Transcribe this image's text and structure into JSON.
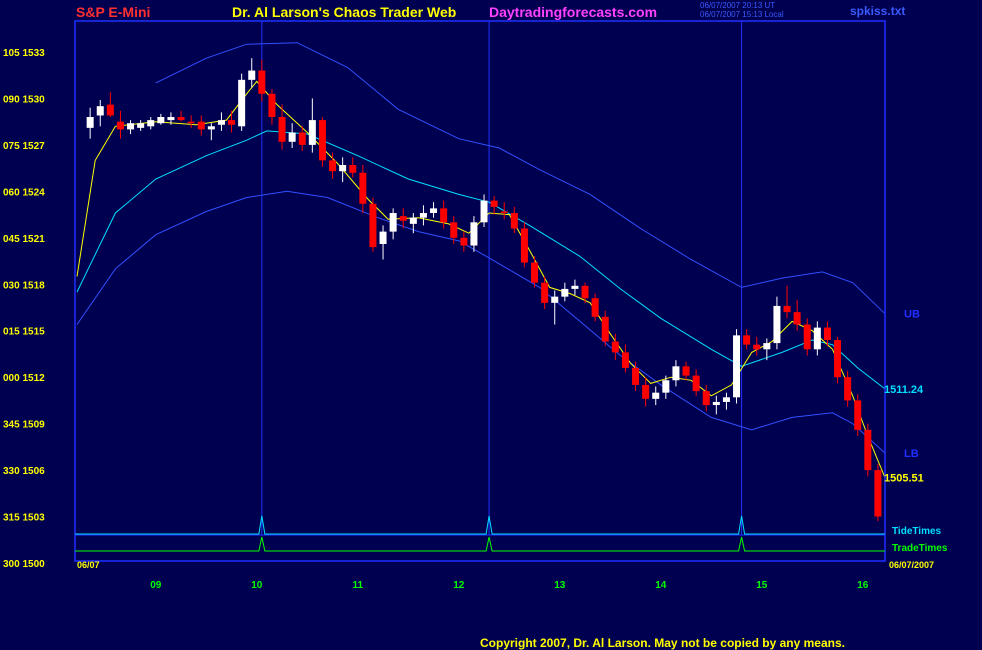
{
  "header": {
    "symbol": "S&P E-Mini",
    "title": "Dr. Al Larson's Chaos Trader Web",
    "site": "Daytradingforecasts.com",
    "stamp_utc": "06/07/2007 20:13 UT",
    "stamp_local": "06/07/2007 15:13 Local",
    "file": "spkiss.txt"
  },
  "footer": {
    "copyright": "Copyright 2007, Dr. Al Larson. May not be copied by any means."
  },
  "colors": {
    "background": "#000050",
    "frame": "#2030ff",
    "up_candle": "#ffffff",
    "down_candle": "#ff0000",
    "short_ema": "#ffff00",
    "center_band": "#00e0ff",
    "outer_band": "#3050ff",
    "tide_times": "#00e0ff",
    "trade_times": "#00ff00",
    "label_yellow": "#ffff00",
    "label_green": "#00ff00"
  },
  "chart_data": {
    "type": "candlestick",
    "x_range": [
      8.2,
      16.22
    ],
    "y_range": [
      1500,
      1535
    ],
    "y_ticks": [
      1500,
      1503,
      1506,
      1509,
      1512,
      1515,
      1518,
      1521,
      1524,
      1527,
      1530,
      1533
    ],
    "y_tick_labels": [
      "300 1500",
      "315 1503",
      "330 1506",
      "345 1509",
      "000 1512",
      "015 1515",
      "030 1518",
      "045 1521",
      "060 1524",
      "075 1527",
      "090 1530",
      "105 1533"
    ],
    "x_ticks": [
      9,
      10,
      11,
      12,
      13,
      14,
      15,
      16
    ],
    "x_tick_labels": [
      "09",
      "10",
      "11",
      "12",
      "13",
      "14",
      "15",
      "16"
    ],
    "date_left": "06/07",
    "date_right": "06/07/2007",
    "timing_lines": [
      10.05,
      12.3,
      14.8
    ],
    "band_labels": [
      {
        "text": "UB",
        "value": 1516.1
      },
      {
        "text": "1511.24",
        "value": 1511.24
      },
      {
        "text": "LB",
        "value": 1507.1
      },
      {
        "text": "1505.51",
        "value": 1505.51
      }
    ],
    "timing_labels": [
      "TideTimes",
      "TradeTimes"
    ],
    "candles": [
      {
        "t": 8.35,
        "o": 1528.1,
        "h": 1529.4,
        "l": 1527.4,
        "c": 1528.8
      },
      {
        "t": 8.45,
        "o": 1528.9,
        "h": 1529.9,
        "l": 1528.2,
        "c": 1529.5
      },
      {
        "t": 8.55,
        "o": 1529.6,
        "h": 1530.4,
        "l": 1528.8,
        "c": 1528.9
      },
      {
        "t": 8.65,
        "o": 1528.5,
        "h": 1529.2,
        "l": 1527.4,
        "c": 1528.0
      },
      {
        "t": 8.75,
        "o": 1528.0,
        "h": 1528.6,
        "l": 1527.7,
        "c": 1528.4
      },
      {
        "t": 8.85,
        "o": 1528.1,
        "h": 1528.6,
        "l": 1527.9,
        "c": 1528.4
      },
      {
        "t": 8.95,
        "o": 1528.2,
        "h": 1528.8,
        "l": 1528.0,
        "c": 1528.6
      },
      {
        "t": 9.05,
        "o": 1528.4,
        "h": 1529.0,
        "l": 1528.3,
        "c": 1528.8
      },
      {
        "t": 9.15,
        "o": 1528.6,
        "h": 1529.1,
        "l": 1528.3,
        "c": 1528.8
      },
      {
        "t": 9.25,
        "o": 1528.8,
        "h": 1529.2,
        "l": 1528.5,
        "c": 1528.6
      },
      {
        "t": 9.35,
        "o": 1528.5,
        "h": 1528.9,
        "l": 1528.1,
        "c": 1528.4
      },
      {
        "t": 9.45,
        "o": 1528.5,
        "h": 1528.9,
        "l": 1527.6,
        "c": 1528.0
      },
      {
        "t": 9.55,
        "o": 1528.0,
        "h": 1528.4,
        "l": 1527.3,
        "c": 1528.2
      },
      {
        "t": 9.65,
        "o": 1528.3,
        "h": 1529.1,
        "l": 1527.9,
        "c": 1528.6
      },
      {
        "t": 9.75,
        "o": 1528.6,
        "h": 1529.2,
        "l": 1527.8,
        "c": 1528.3
      },
      {
        "t": 9.85,
        "o": 1528.2,
        "h": 1531.6,
        "l": 1527.9,
        "c": 1531.2
      },
      {
        "t": 9.95,
        "o": 1531.2,
        "h": 1532.6,
        "l": 1530.7,
        "c": 1531.8
      },
      {
        "t": 10.05,
        "o": 1531.8,
        "h": 1532.5,
        "l": 1529.8,
        "c": 1530.3
      },
      {
        "t": 10.15,
        "o": 1530.3,
        "h": 1530.6,
        "l": 1528.3,
        "c": 1528.8
      },
      {
        "t": 10.25,
        "o": 1528.8,
        "h": 1529.6,
        "l": 1526.7,
        "c": 1527.2
      },
      {
        "t": 10.35,
        "o": 1527.2,
        "h": 1528.4,
        "l": 1526.8,
        "c": 1527.8
      },
      {
        "t": 10.45,
        "o": 1527.8,
        "h": 1528.2,
        "l": 1526.6,
        "c": 1527.0
      },
      {
        "t": 10.55,
        "o": 1527.0,
        "h": 1530.0,
        "l": 1526.5,
        "c": 1528.6
      },
      {
        "t": 10.65,
        "o": 1528.6,
        "h": 1528.8,
        "l": 1525.6,
        "c": 1526.0
      },
      {
        "t": 10.75,
        "o": 1526.0,
        "h": 1526.5,
        "l": 1524.8,
        "c": 1525.3
      },
      {
        "t": 10.85,
        "o": 1525.3,
        "h": 1526.2,
        "l": 1524.6,
        "c": 1525.7
      },
      {
        "t": 10.95,
        "o": 1525.7,
        "h": 1526.2,
        "l": 1524.9,
        "c": 1525.2
      },
      {
        "t": 11.05,
        "o": 1525.2,
        "h": 1525.7,
        "l": 1522.6,
        "c": 1523.2
      },
      {
        "t": 11.15,
        "o": 1523.2,
        "h": 1523.6,
        "l": 1520.1,
        "c": 1520.4
      },
      {
        "t": 11.25,
        "o": 1520.6,
        "h": 1521.8,
        "l": 1519.6,
        "c": 1521.4
      },
      {
        "t": 11.35,
        "o": 1521.4,
        "h": 1522.9,
        "l": 1520.9,
        "c": 1522.6
      },
      {
        "t": 11.45,
        "o": 1522.4,
        "h": 1522.9,
        "l": 1521.6,
        "c": 1522.1
      },
      {
        "t": 11.55,
        "o": 1521.9,
        "h": 1522.6,
        "l": 1521.3,
        "c": 1522.3
      },
      {
        "t": 11.65,
        "o": 1522.3,
        "h": 1523.1,
        "l": 1521.8,
        "c": 1522.6
      },
      {
        "t": 11.75,
        "o": 1522.6,
        "h": 1523.3,
        "l": 1522.3,
        "c": 1522.9
      },
      {
        "t": 11.85,
        "o": 1522.9,
        "h": 1523.4,
        "l": 1521.6,
        "c": 1522.0
      },
      {
        "t": 11.95,
        "o": 1522.0,
        "h": 1522.4,
        "l": 1520.6,
        "c": 1521.0
      },
      {
        "t": 12.05,
        "o": 1521.0,
        "h": 1521.4,
        "l": 1520.1,
        "c": 1520.5
      },
      {
        "t": 12.15,
        "o": 1520.5,
        "h": 1522.4,
        "l": 1520.1,
        "c": 1522.0
      },
      {
        "t": 12.25,
        "o": 1522.0,
        "h": 1523.8,
        "l": 1521.7,
        "c": 1523.4
      },
      {
        "t": 12.35,
        "o": 1523.4,
        "h": 1523.7,
        "l": 1522.5,
        "c": 1523.0
      },
      {
        "t": 12.45,
        "o": 1522.7,
        "h": 1523.3,
        "l": 1522.2,
        "c": 1522.6
      },
      {
        "t": 12.55,
        "o": 1522.6,
        "h": 1523.0,
        "l": 1521.3,
        "c": 1521.6
      },
      {
        "t": 12.65,
        "o": 1521.6,
        "h": 1522.0,
        "l": 1519.1,
        "c": 1519.4
      },
      {
        "t": 12.75,
        "o": 1519.4,
        "h": 1519.8,
        "l": 1517.8,
        "c": 1518.1
      },
      {
        "t": 12.85,
        "o": 1518.1,
        "h": 1518.5,
        "l": 1516.4,
        "c": 1516.8
      },
      {
        "t": 12.95,
        "o": 1516.8,
        "h": 1517.6,
        "l": 1515.4,
        "c": 1517.2
      },
      {
        "t": 13.05,
        "o": 1517.2,
        "h": 1518.1,
        "l": 1516.9,
        "c": 1517.7
      },
      {
        "t": 13.15,
        "o": 1517.7,
        "h": 1518.3,
        "l": 1517.3,
        "c": 1517.9
      },
      {
        "t": 13.25,
        "o": 1517.9,
        "h": 1518.1,
        "l": 1516.8,
        "c": 1517.1
      },
      {
        "t": 13.35,
        "o": 1517.1,
        "h": 1517.4,
        "l": 1515.6,
        "c": 1515.9
      },
      {
        "t": 13.45,
        "o": 1515.9,
        "h": 1516.3,
        "l": 1514.0,
        "c": 1514.3
      },
      {
        "t": 13.55,
        "o": 1514.3,
        "h": 1514.8,
        "l": 1513.1,
        "c": 1513.6
      },
      {
        "t": 13.65,
        "o": 1513.6,
        "h": 1514.1,
        "l": 1512.3,
        "c": 1512.6
      },
      {
        "t": 13.75,
        "o": 1512.6,
        "h": 1513.0,
        "l": 1511.1,
        "c": 1511.5
      },
      {
        "t": 13.85,
        "o": 1511.5,
        "h": 1512.0,
        "l": 1510.1,
        "c": 1510.6
      },
      {
        "t": 13.95,
        "o": 1510.6,
        "h": 1511.4,
        "l": 1510.2,
        "c": 1511.0
      },
      {
        "t": 14.05,
        "o": 1511.0,
        "h": 1512.1,
        "l": 1510.6,
        "c": 1511.8
      },
      {
        "t": 14.15,
        "o": 1511.8,
        "h": 1513.1,
        "l": 1511.4,
        "c": 1512.7
      },
      {
        "t": 14.25,
        "o": 1512.7,
        "h": 1513.0,
        "l": 1511.8,
        "c": 1512.1
      },
      {
        "t": 14.35,
        "o": 1512.1,
        "h": 1512.5,
        "l": 1510.8,
        "c": 1511.1
      },
      {
        "t": 14.45,
        "o": 1511.1,
        "h": 1511.5,
        "l": 1509.8,
        "c": 1510.2
      },
      {
        "t": 14.55,
        "o": 1510.2,
        "h": 1510.8,
        "l": 1509.6,
        "c": 1510.4
      },
      {
        "t": 14.65,
        "o": 1510.4,
        "h": 1511.0,
        "l": 1509.9,
        "c": 1510.7
      },
      {
        "t": 14.75,
        "o": 1510.7,
        "h": 1515.1,
        "l": 1510.3,
        "c": 1514.7
      },
      {
        "t": 14.85,
        "o": 1514.7,
        "h": 1515.1,
        "l": 1513.8,
        "c": 1514.1
      },
      {
        "t": 14.95,
        "o": 1514.1,
        "h": 1514.6,
        "l": 1513.4,
        "c": 1513.8
      },
      {
        "t": 15.05,
        "o": 1513.8,
        "h": 1514.5,
        "l": 1513.1,
        "c": 1514.2
      },
      {
        "t": 15.15,
        "o": 1514.2,
        "h": 1517.2,
        "l": 1513.8,
        "c": 1516.6
      },
      {
        "t": 15.25,
        "o": 1516.6,
        "h": 1517.9,
        "l": 1515.8,
        "c": 1516.2
      },
      {
        "t": 15.35,
        "o": 1516.2,
        "h": 1517.0,
        "l": 1515.0,
        "c": 1515.4
      },
      {
        "t": 15.45,
        "o": 1515.4,
        "h": 1515.8,
        "l": 1513.4,
        "c": 1513.8
      },
      {
        "t": 15.55,
        "o": 1513.8,
        "h": 1515.6,
        "l": 1513.4,
        "c": 1515.2
      },
      {
        "t": 15.65,
        "o": 1515.2,
        "h": 1515.6,
        "l": 1514.0,
        "c": 1514.4
      },
      {
        "t": 15.75,
        "o": 1514.4,
        "h": 1514.6,
        "l": 1511.6,
        "c": 1512.0
      },
      {
        "t": 15.85,
        "o": 1512.0,
        "h": 1512.4,
        "l": 1510.1,
        "c": 1510.5
      },
      {
        "t": 15.95,
        "o": 1510.5,
        "h": 1510.9,
        "l": 1508.2,
        "c": 1508.6
      },
      {
        "t": 16.05,
        "o": 1508.6,
        "h": 1509.0,
        "l": 1505.6,
        "c": 1506.0
      },
      {
        "t": 16.15,
        "o": 1506.0,
        "h": 1506.4,
        "l": 1502.7,
        "c": 1503.0
      }
    ],
    "series": [
      {
        "values": [
          [
            8.22,
            1518.5
          ],
          [
            8.4,
            1526
          ],
          [
            8.6,
            1528.2
          ],
          [
            9.0,
            1528.5
          ],
          [
            9.4,
            1528.3
          ],
          [
            9.7,
            1528.6
          ],
          [
            9.9,
            1530.3
          ],
          [
            10.0,
            1531.1
          ],
          [
            10.2,
            1529.6
          ],
          [
            10.5,
            1527.8
          ],
          [
            10.8,
            1525.8
          ],
          [
            11.1,
            1523.5
          ],
          [
            11.3,
            1522.2
          ],
          [
            11.6,
            1522.3
          ],
          [
            11.9,
            1521.9
          ],
          [
            12.1,
            1521.3
          ],
          [
            12.3,
            1522.6
          ],
          [
            12.5,
            1522.5
          ],
          [
            12.7,
            1520.2
          ],
          [
            12.9,
            1517.8
          ],
          [
            13.1,
            1517.4
          ],
          [
            13.3,
            1516.8
          ],
          [
            13.5,
            1514.8
          ],
          [
            13.7,
            1512.9
          ],
          [
            13.9,
            1511.6
          ],
          [
            14.1,
            1512.0
          ],
          [
            14.3,
            1511.8
          ],
          [
            14.5,
            1510.8
          ],
          [
            14.7,
            1511.5
          ],
          [
            14.9,
            1513.6
          ],
          [
            15.1,
            1514.3
          ],
          [
            15.3,
            1515.6
          ],
          [
            15.5,
            1515.0
          ],
          [
            15.7,
            1513.8
          ],
          [
            15.9,
            1510.8
          ],
          [
            16.05,
            1508.2
          ],
          [
            16.22,
            1505.51
          ]
        ]
      },
      {
        "values": [
          [
            8.22,
            1517.5
          ],
          [
            8.6,
            1522.6
          ],
          [
            9.0,
            1524.8
          ],
          [
            9.5,
            1526.3
          ],
          [
            9.9,
            1527.3
          ],
          [
            10.1,
            1527.9
          ],
          [
            10.5,
            1527.7
          ],
          [
            11.0,
            1526.3
          ],
          [
            11.5,
            1524.8
          ],
          [
            12.0,
            1523.8
          ],
          [
            12.3,
            1523.3
          ],
          [
            12.7,
            1521.8
          ],
          [
            13.2,
            1519.8
          ],
          [
            13.6,
            1517.7
          ],
          [
            14.0,
            1515.8
          ],
          [
            14.5,
            1513.8
          ],
          [
            14.8,
            1512.7
          ],
          [
            15.2,
            1513.6
          ],
          [
            15.5,
            1514.4
          ],
          [
            15.7,
            1514.1
          ],
          [
            15.95,
            1512.6
          ],
          [
            16.22,
            1511.24
          ]
        ]
      },
      {
        "values": [
          [
            8.22,
            1515.4
          ],
          [
            8.6,
            1519.0
          ],
          [
            9.0,
            1521.2
          ],
          [
            9.5,
            1522.7
          ],
          [
            9.9,
            1523.6
          ],
          [
            10.3,
            1524.0
          ],
          [
            10.7,
            1523.6
          ],
          [
            11.2,
            1522.3
          ],
          [
            11.6,
            1521.4
          ],
          [
            12.0,
            1520.8
          ],
          [
            12.3,
            1519.7
          ],
          [
            12.8,
            1517.8
          ],
          [
            13.2,
            1515.6
          ],
          [
            13.6,
            1513.4
          ],
          [
            14.0,
            1511.5
          ],
          [
            14.5,
            1509.4
          ],
          [
            14.9,
            1508.6
          ],
          [
            15.3,
            1509.4
          ],
          [
            15.7,
            1509.7
          ],
          [
            15.9,
            1509.0
          ],
          [
            16.22,
            1507.1
          ]
        ]
      },
      {
        "values": [
          [
            9.0,
            1531.0
          ],
          [
            9.5,
            1532.6
          ],
          [
            9.9,
            1533.5
          ],
          [
            10.4,
            1533.6
          ],
          [
            10.9,
            1532.0
          ],
          [
            11.4,
            1529.3
          ],
          [
            12.0,
            1527.4
          ],
          [
            12.4,
            1526.8
          ],
          [
            12.8,
            1525.4
          ],
          [
            13.3,
            1523.8
          ],
          [
            13.8,
            1521.6
          ],
          [
            14.3,
            1519.6
          ],
          [
            14.8,
            1517.8
          ],
          [
            15.2,
            1518.4
          ],
          [
            15.6,
            1518.8
          ],
          [
            15.9,
            1518.1
          ],
          [
            16.22,
            1516.1
          ]
        ]
      }
    ]
  }
}
